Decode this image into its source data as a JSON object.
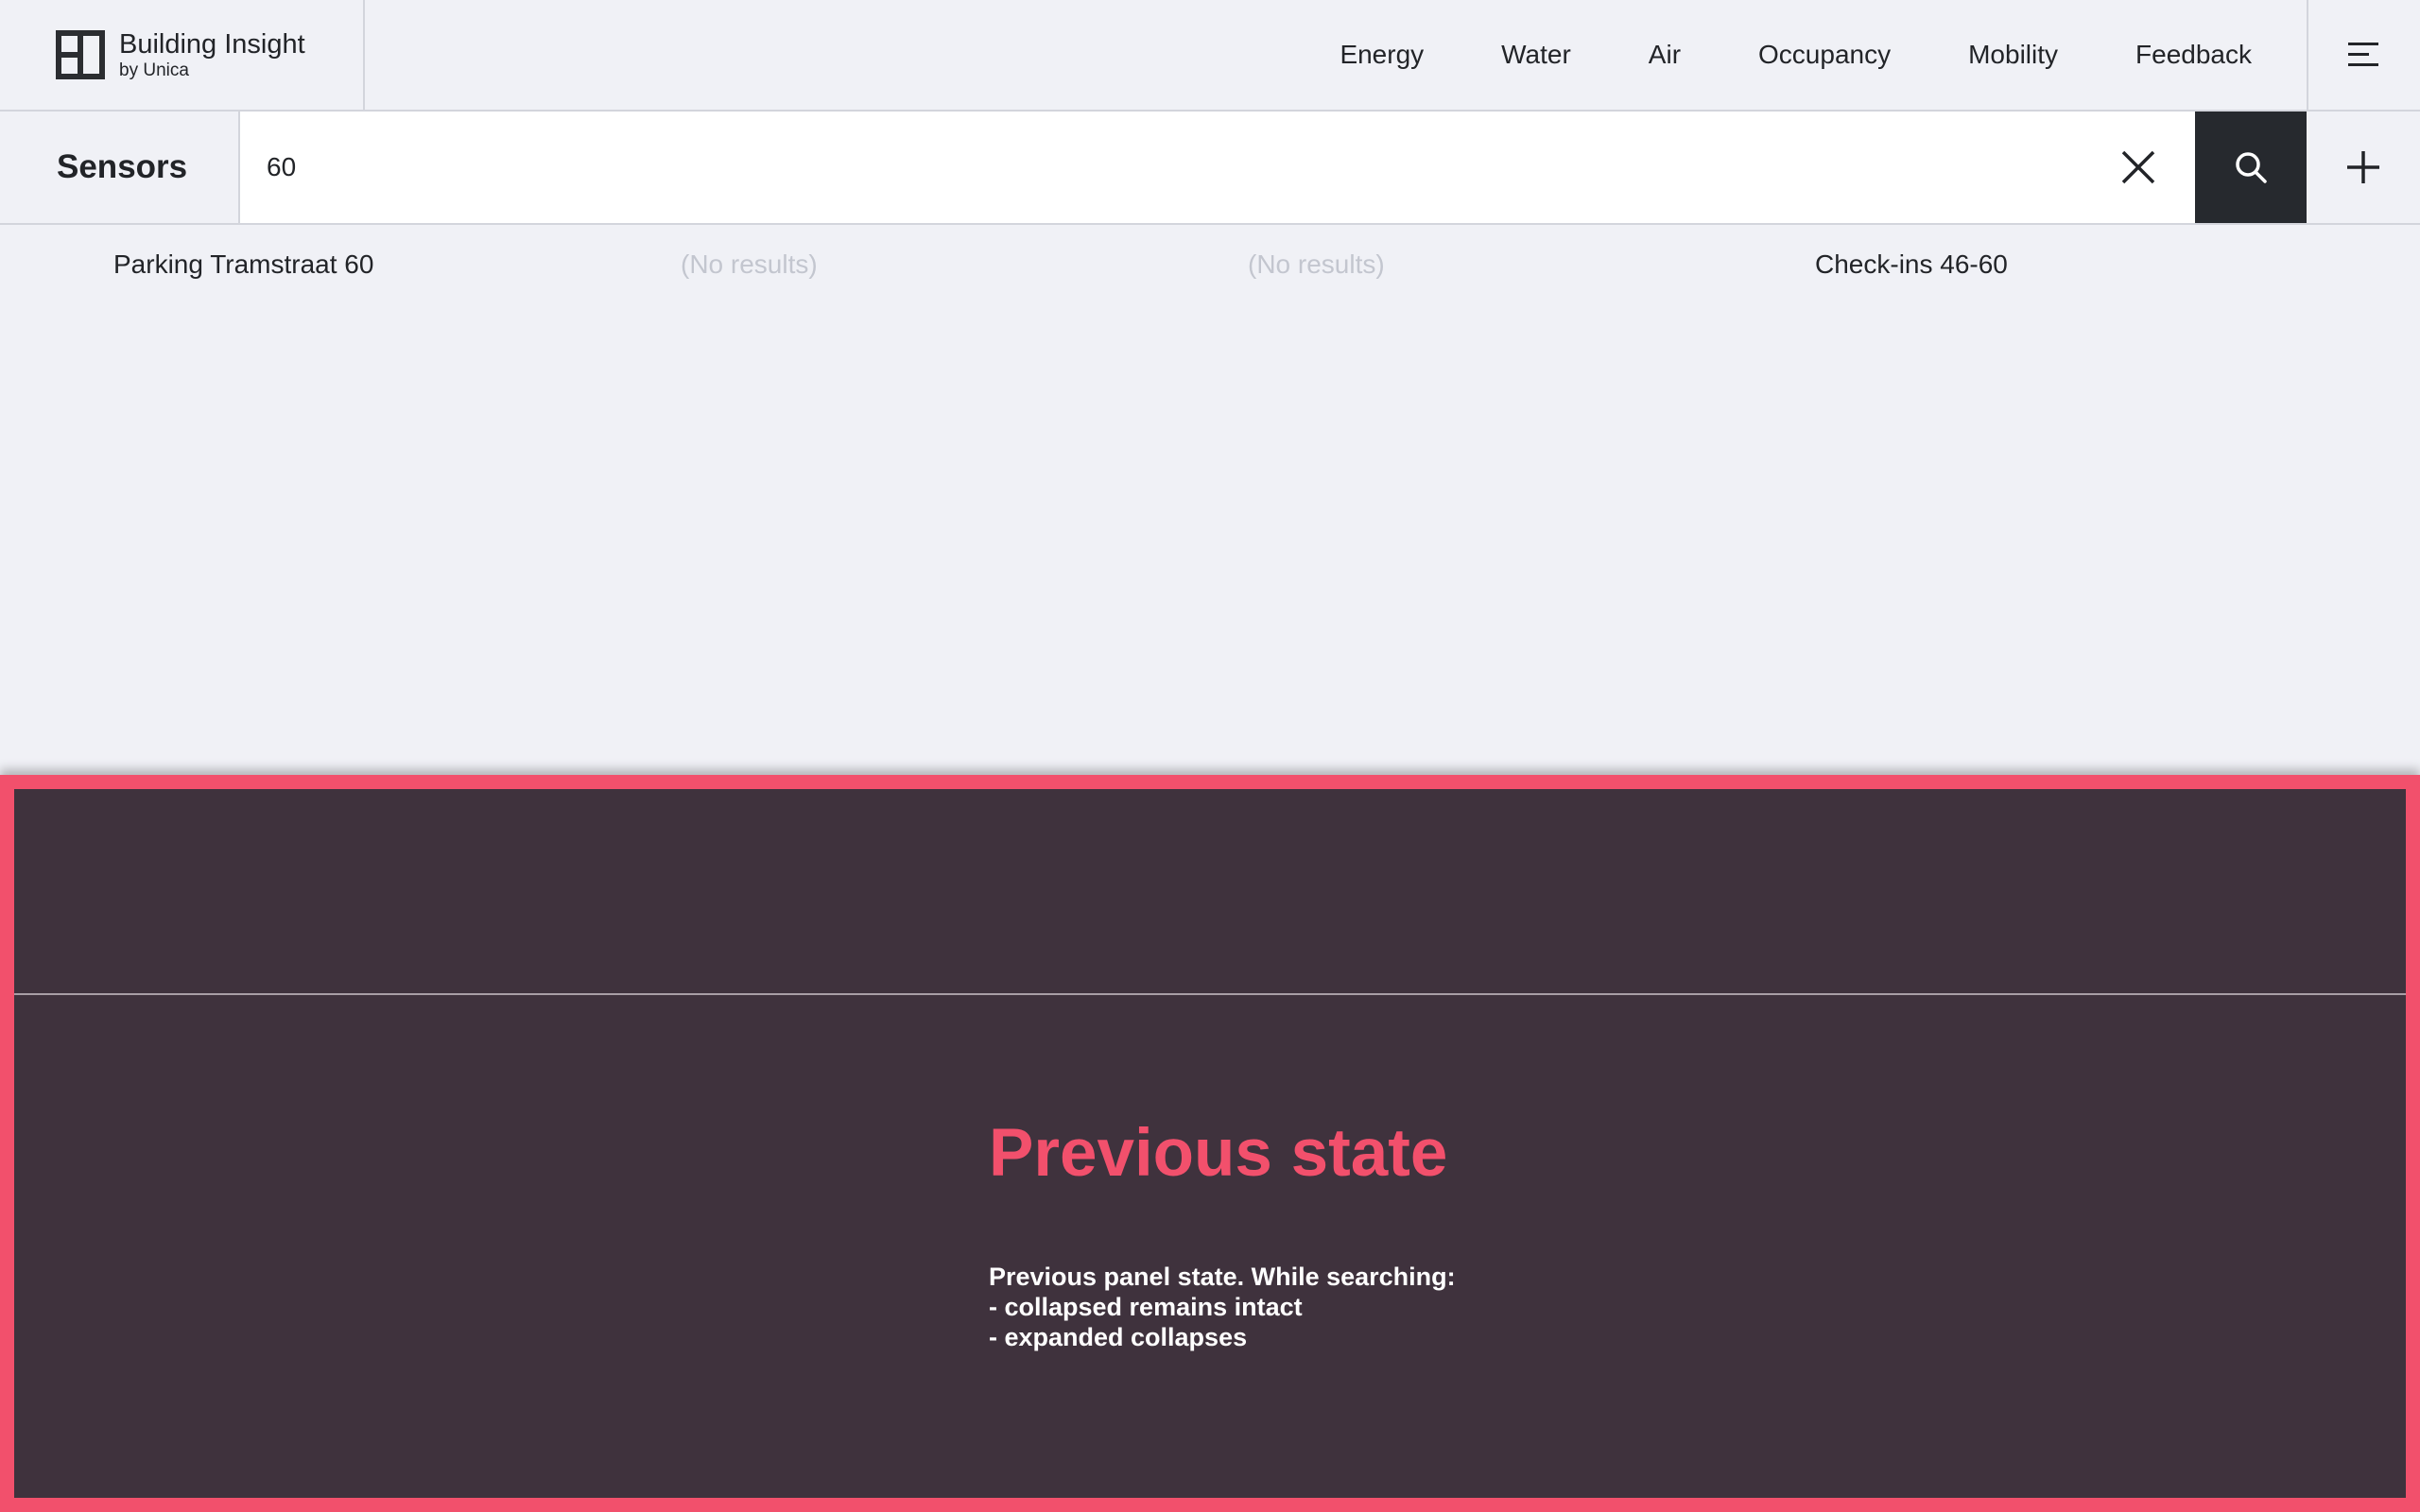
{
  "brand": {
    "title": "Building Insight",
    "subtitle": "by Unica",
    "logo_icon": "building-insight-logo-icon"
  },
  "nav": {
    "items": [
      "Energy",
      "Water",
      "Air",
      "Occupancy",
      "Mobility",
      "Feedback"
    ],
    "menu_icon": "hamburger-menu-icon"
  },
  "search": {
    "title": "Sensors",
    "value": "60",
    "clear_icon": "close-icon",
    "search_icon": "search-icon",
    "add_icon": "plus-icon"
  },
  "results": [
    {
      "text": "Parking Tramstraat 60",
      "empty": false
    },
    {
      "text": "(No results)",
      "empty": true
    },
    {
      "text": "(No results)",
      "empty": true
    },
    {
      "text": "Check-ins 46-60",
      "empty": false
    }
  ],
  "annotation": {
    "title": "Previous state",
    "lines": [
      "Previous panel state. While searching:",
      "- collapsed remains intact",
      "- expanded collapses"
    ]
  },
  "colors": {
    "background": "#f0f1f6",
    "text": "#222428",
    "muted_text": "#c3c6cf",
    "search_button": "#26292e",
    "annotation_background": "#3f323d",
    "annotation_accent": "#f2506c"
  }
}
